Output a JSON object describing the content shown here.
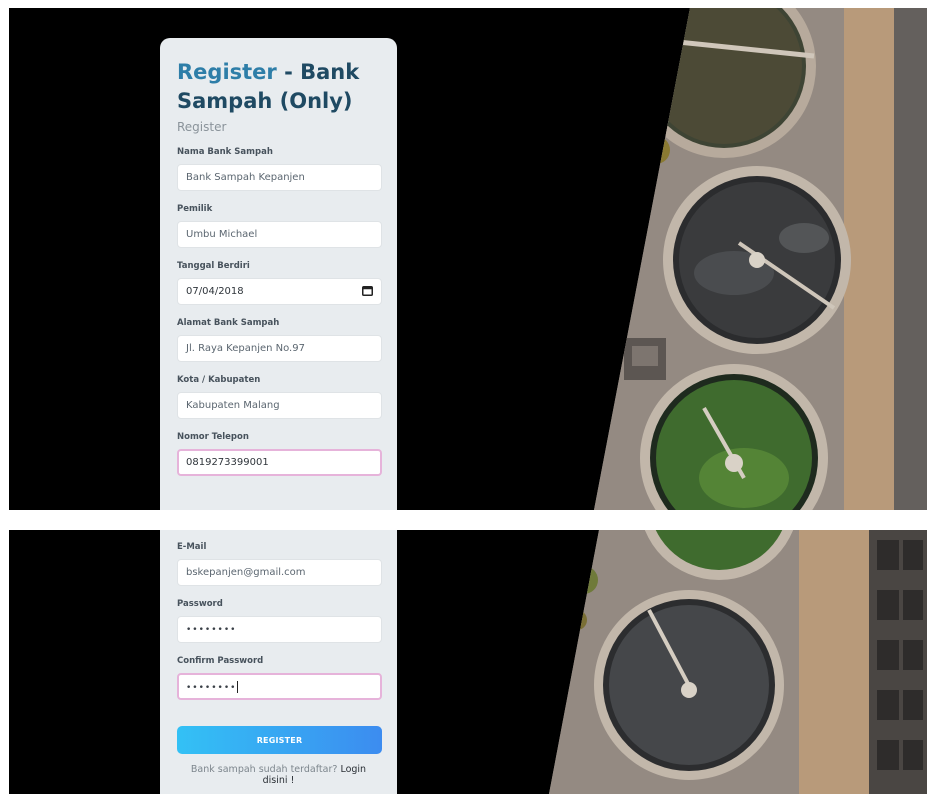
{
  "header": {
    "title_part1": "Register",
    "title_part2": "- Bank Sampah (Only)",
    "subtitle": "Register"
  },
  "fields": [
    {
      "label": "Nama Bank Sampah",
      "value": "Bank Sampah Kepanjen"
    },
    {
      "label": "Pemilik",
      "value": "Umbu Michael"
    },
    {
      "label": "Tanggal Berdiri",
      "value": "07/04/2018"
    },
    {
      "label": "Alamat Bank Sampah",
      "value": "Jl. Raya Kepanjen No.97"
    },
    {
      "label": "Kota / Kabupaten",
      "value": "Kabupaten Malang"
    },
    {
      "label": "Nomor Telepon",
      "value": "0819273399001"
    },
    {
      "label": "E-Mail",
      "value": "bskepanjen@gmail.com"
    },
    {
      "label": "Password",
      "value": "••••••••"
    },
    {
      "label": "Confirm Password",
      "value": "••••••••"
    }
  ],
  "icons": {
    "date_picker": "calendar-icon"
  },
  "submit_label": "REGISTER",
  "footer": {
    "question": "Bank sampah sudah terdaftar?",
    "link": "Login disini !"
  },
  "colors": {
    "title": "#1f4a63",
    "title_accent": "#2e7ea8",
    "focus_border": "#e6b3da",
    "button_start": "#33c1f5",
    "button_end": "#3c8cf0"
  }
}
